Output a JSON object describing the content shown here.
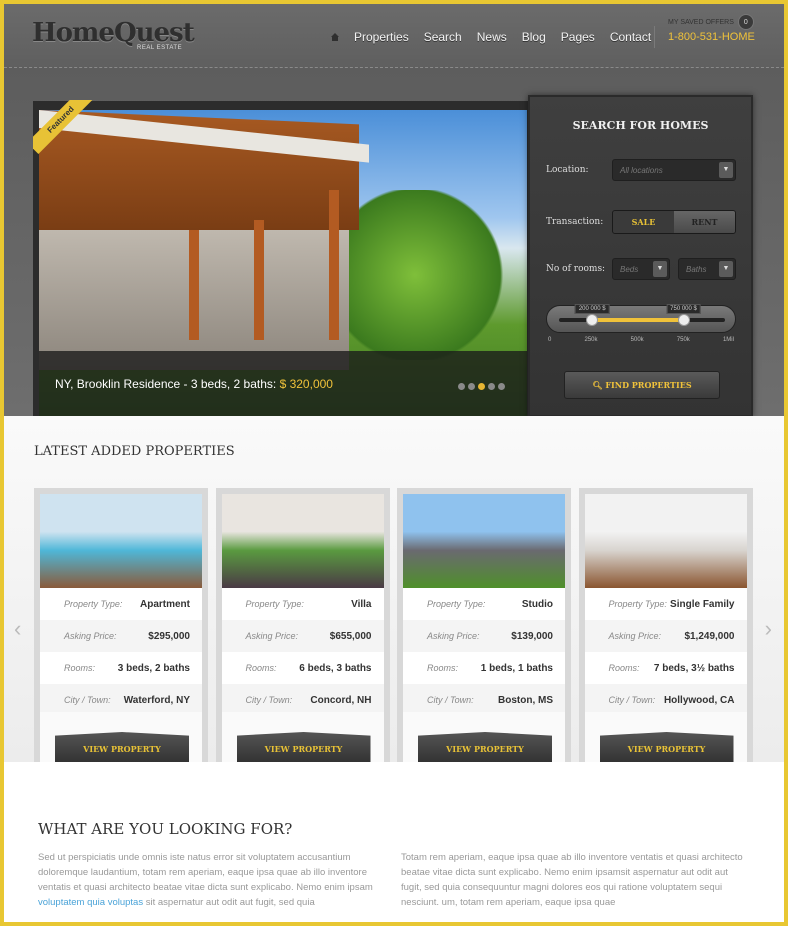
{
  "header": {
    "logo": "HomeQuest",
    "logo_sub": "REAL ESTATE",
    "nav": [
      "Properties",
      "Search",
      "News",
      "Blog",
      "Pages",
      "Contact"
    ],
    "saved_label": "MY SAVED OFFERS",
    "saved_count": "0",
    "phone": "1-800-531-HOME"
  },
  "hero": {
    "ribbon": "Featured",
    "caption": "NY, Brooklin Residence - 3 beds, 2 baths: ",
    "price": "$ 320,000",
    "slides": 5,
    "active_slide": 3
  },
  "search": {
    "title": "SEARCH FOR HOMES",
    "location_label": "Location:",
    "location_value": "All locations",
    "transaction_label": "Transaction:",
    "sale": "SALE",
    "rent": "RENT",
    "rooms_label": "No of rooms:",
    "beds": "Beds",
    "baths": "Baths",
    "range_min_label": "200 000 $",
    "range_max_label": "750 000 $",
    "range_min_fraction": 0.2,
    "range_max_fraction": 0.75,
    "ticks": [
      "0",
      "250k",
      "500k",
      "750k",
      "1Mil"
    ],
    "button": "FIND PROPERTIES"
  },
  "latest": {
    "title": "LATEST ADDED PROPERTIES",
    "labels": {
      "type": "Property Type:",
      "price": "Asking Price:",
      "rooms": "Rooms:",
      "city": "City / Town:"
    },
    "button": "VIEW PROPERTY",
    "cards": [
      {
        "type": "Apartment",
        "price": "$295,000",
        "rooms": "3 beds, 2 baths",
        "city": "Waterford, NY",
        "colors": [
          "#cfe3f0",
          "#4fb7d8",
          "#8a5a3a"
        ]
      },
      {
        "type": "Villa",
        "price": "$655,000",
        "rooms": "6 beds, 3 baths",
        "city": "Concord, NH",
        "colors": [
          "#e9e5e0",
          "#5a9a40",
          "#4a3a45"
        ]
      },
      {
        "type": "Studio",
        "price": "$139,000",
        "rooms": "1 beds, 1 baths",
        "city": "Boston, MS",
        "colors": [
          "#8fc2ee",
          "#6a6a70",
          "#4f8f2a"
        ]
      },
      {
        "type": "Single Family",
        "price": "$1,249,000",
        "rooms": "7 beds, 3½ baths",
        "city": "Hollywood, CA",
        "colors": [
          "#f2f2f2",
          "#d8d4cf",
          "#8a5530"
        ]
      }
    ]
  },
  "what": {
    "title": "WHAT ARE YOU LOOKING FOR?",
    "col1_a": "Sed ut perspiciatis unde omnis iste natus error sit voluptatem accusantium doloremque laudantium, totam rem aperiam, eaque ipsa quae ab illo inventore ventatis et quasi architecto beatae vitae dicta sunt explicabo. Nemo enim ipsam ",
    "col1_link": "voluptatem quia voluptas",
    "col1_b": " sit aspernatur aut odit aut fugit, sed quia",
    "col2": "Totam rem aperiam, eaque ipsa quae ab illo inventore ventatis et quasi architecto beatae vitae dicta sunt explicabo. Nemo enim ipsamsit aspernatur aut odit aut fugit, sed quia consequuntur magni dolores eos qui ratione voluptatem sequi nesciunt. um, totam rem aperiam, eaque ipsa quae"
  }
}
